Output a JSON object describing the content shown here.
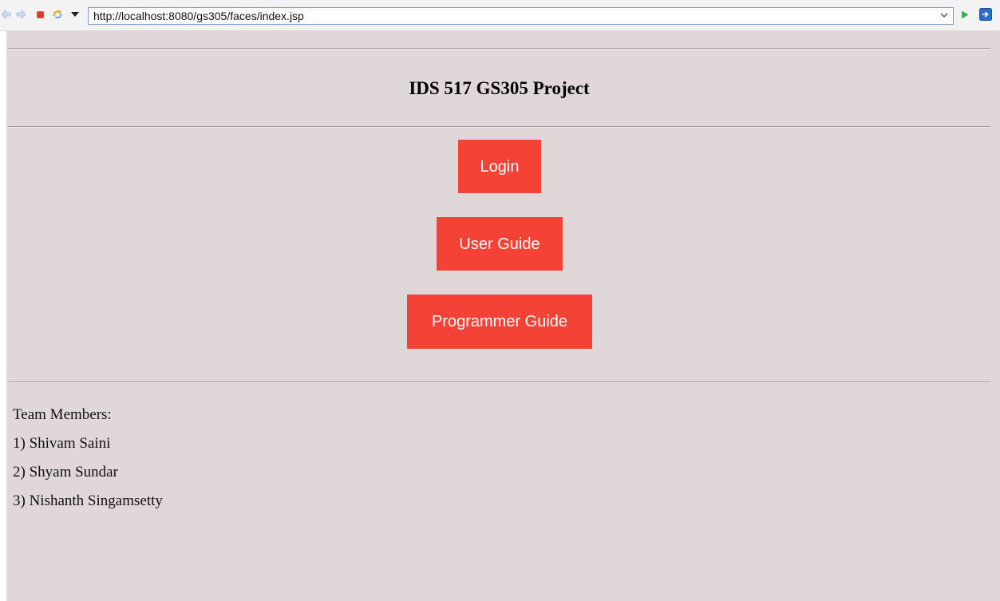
{
  "browser": {
    "url": "http://localhost:8080/gs305/faces/index.jsp",
    "colors": {
      "back_arrow": "#b9cde3",
      "stop": "#e0392f",
      "go": "#34b34a"
    }
  },
  "page": {
    "title": "IDS 517 GS305 Project",
    "background": "#e0d7d8",
    "buttons": {
      "login": "Login",
      "user_guide": "User Guide",
      "programmer_guide": "Programmer Guide"
    },
    "button_color": "#f44336",
    "team": {
      "heading": "Team Members:",
      "members": [
        "1) Shivam Saini",
        "2) Shyam Sundar",
        "3) Nishanth Singamsetty"
      ]
    }
  }
}
